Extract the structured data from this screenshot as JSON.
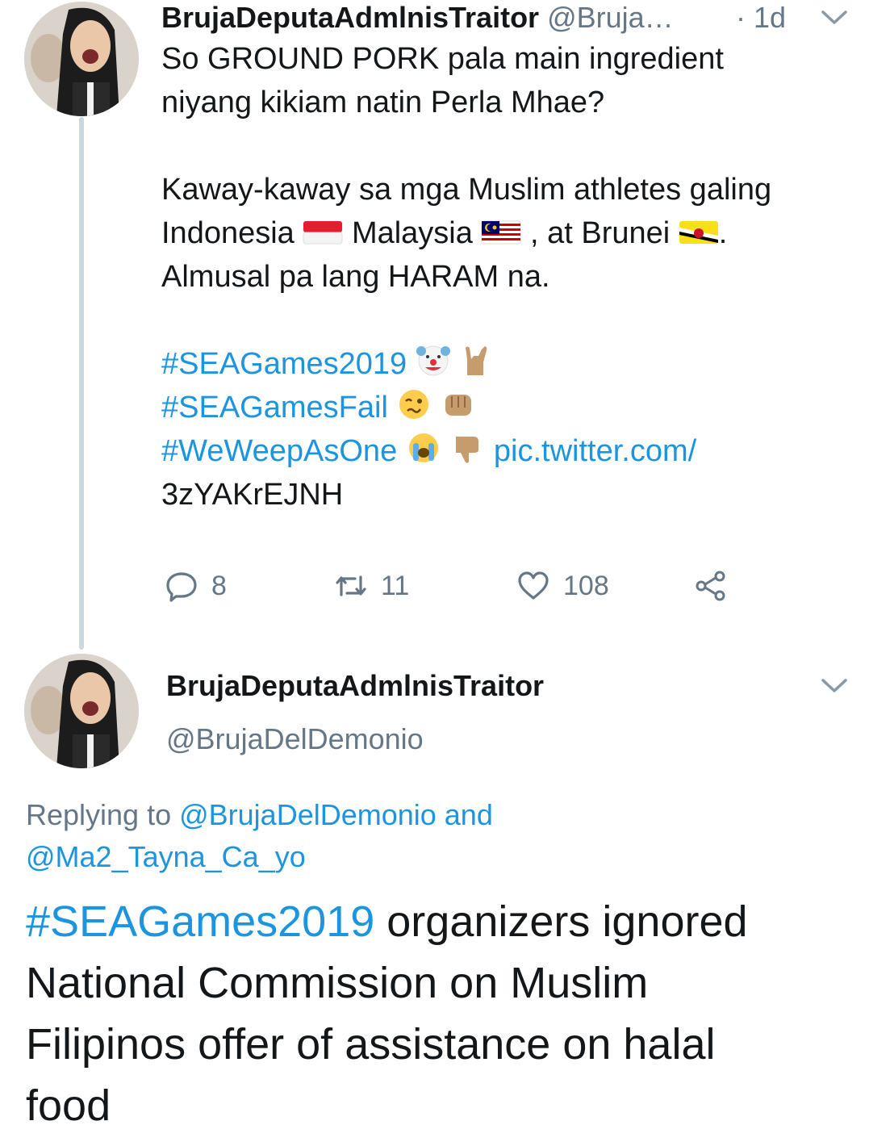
{
  "tweet1": {
    "display_name": "BrujaDeputaAdmlnisTraitor",
    "handle": "@Bruja…",
    "time": "· 1d",
    "line1": "So GROUND PORK pala main ingredient",
    "line2": "niyang kikiam natin Perla Mhae?",
    "line3": "Kaway-kaway sa mga Muslim athletes galing",
    "line4_a": "Indonesia",
    "line4_b": "Malaysia",
    "line4_c": ",  at Brunei",
    "line4_d": ".",
    "line5": "Almusal pa lang HARAM na.",
    "hashtag1": "#SEAGames2019",
    "hashtag2": "#SEAGamesFail",
    "hashtag3": "#WeWeepAsOne",
    "pic_link_a": "pic.twitter.com/",
    "pic_link_b": "3zYAKrEJNH",
    "replies": "8",
    "retweets": "11",
    "likes": "108",
    "icons": [
      "reply-icon",
      "retweet-icon",
      "like-icon",
      "share-icon",
      "chevron-down-icon"
    ]
  },
  "tweet2": {
    "display_name": "BrujaDeputaAdmlnisTraitor",
    "handle": "@BrujaDelDemonio",
    "replying_prefix": "Replying to ",
    "replying_to_1": "@BrujaDelDemonio and",
    "replying_to_2": "@Ma2_Tayna_Ca_yo",
    "hashtag": "#SEAGames2019",
    "text_line1": " organizers ignored",
    "text_line2": "National Commission on Muslim",
    "text_line3": "Filipinos offer of assistance on halal",
    "text_line4": "food"
  },
  "colors": {
    "link": "#1b95e0",
    "secondary_text": "#657786",
    "thread_line": "#ccd6dd"
  }
}
